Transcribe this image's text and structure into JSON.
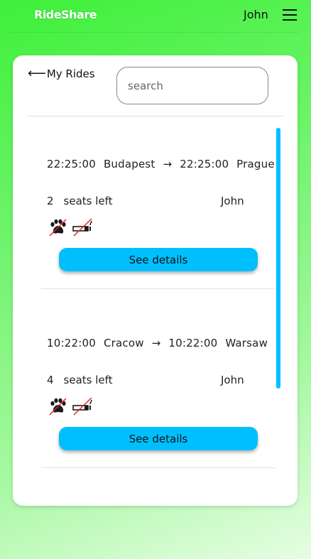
{
  "header": {
    "brand": "RideShare",
    "user": "John",
    "menu_icon": "hamburger-menu-icon"
  },
  "page": {
    "back_label": "My Rides",
    "back_icon": "left-arrow-icon"
  },
  "search": {
    "placeholder": "search",
    "value": ""
  },
  "colors": {
    "accent": "#00bfff",
    "background_gradient_start": "#3ef03a",
    "background_gradient_end": "#e6fde3"
  },
  "rides": [
    {
      "departure_time": "22:25:00",
      "from": "Budapest",
      "arrow": "→",
      "arrival_time": "22:25:00",
      "to": "Prague",
      "seats": "2",
      "seats_label": "seats left",
      "driver": "John",
      "icons": [
        "no-pets-icon",
        "no-smoking-icon"
      ],
      "details_label": "See details"
    },
    {
      "departure_time": "10:22:00",
      "from": "Cracow",
      "arrow": "→",
      "arrival_time": "10:22:00",
      "to": "Warsaw",
      "seats": "4",
      "seats_label": "seats left",
      "driver": "John",
      "icons": [
        "no-pets-icon",
        "no-smoking-icon"
      ],
      "details_label": "See details"
    }
  ]
}
